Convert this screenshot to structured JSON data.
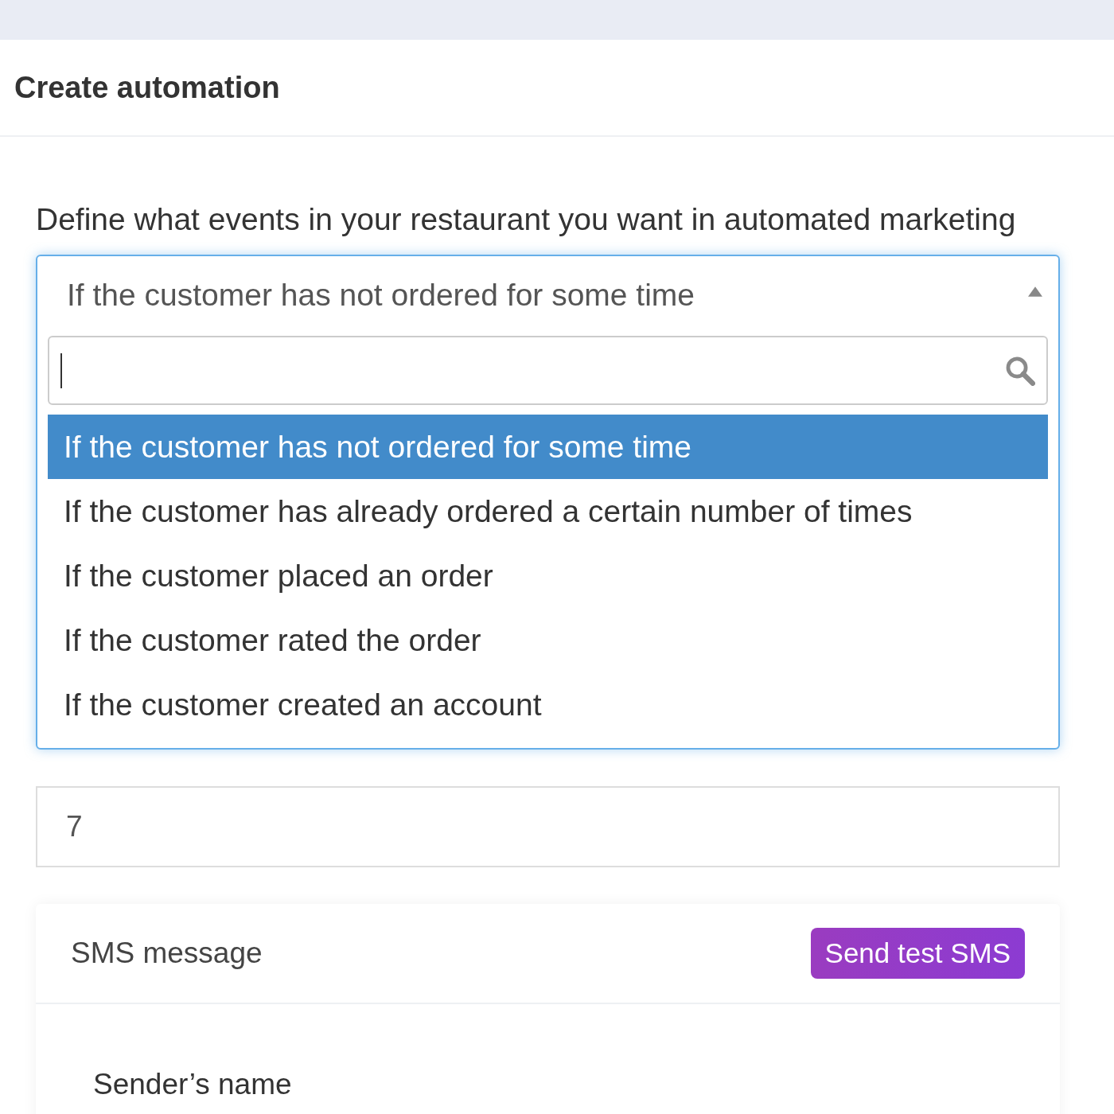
{
  "header": {
    "title": "Create automation"
  },
  "trigger": {
    "label": "Define what events in your restaurant you want in automated marketing",
    "value": "If the customer has not ordered for some time",
    "expanded": true,
    "options": [
      {
        "label": "If the customer has not ordered for some time",
        "selected": true
      },
      {
        "label": "If the customer has already ordered a certain number of times",
        "selected": false
      },
      {
        "label": "If the customer placed an order",
        "selected": false
      },
      {
        "label": "If the customer rated the order",
        "selected": false
      },
      {
        "label": "If the customer created an account",
        "selected": false
      }
    ]
  },
  "days": {
    "value": "7"
  },
  "sms_card": {
    "title": "SMS message",
    "button": "Send test SMS",
    "sender_label": "Sender’s name"
  }
}
